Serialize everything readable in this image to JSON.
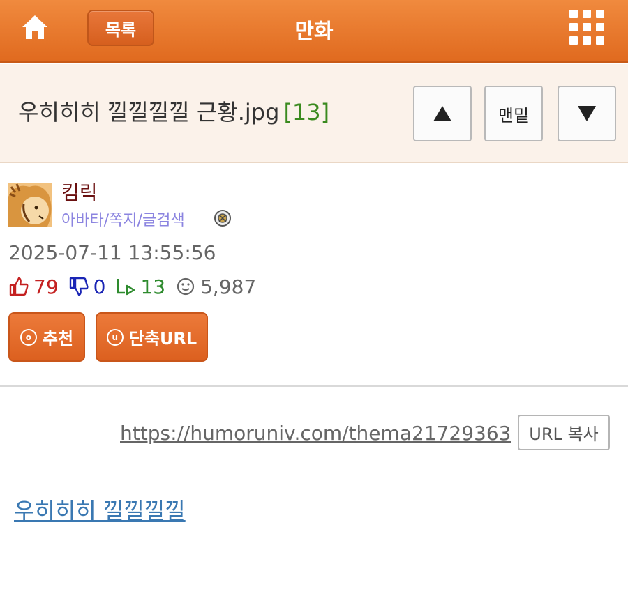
{
  "header": {
    "home_icon": "home-icon",
    "list_label": "목록",
    "title": "만화",
    "menu_icon": "grid-menu-icon"
  },
  "post": {
    "title": "우히히히 낄낄낄낄 근황.jpg",
    "comment_count": "[13]",
    "nav_up_icon": "triangle-up-icon",
    "nav_bottom_label": "맨밑",
    "nav_down_icon": "triangle-down-icon"
  },
  "author": {
    "name": "킴릭",
    "links": "아바타/쪽지/글검색",
    "block_icon": "block-icon"
  },
  "meta": {
    "date": "2025-07-11 13:55:56",
    "upvotes": "79",
    "downvotes": "0",
    "comments": "13",
    "views": "5,987"
  },
  "actions": {
    "recommend_label": "추천",
    "recommend_icon_text": "o",
    "shorturl_label": "단축URL",
    "shorturl_icon_text": "u"
  },
  "url_block": {
    "url": "https://humoruniv.com/thema21729363",
    "copy_label": "URL 복사"
  },
  "content": {
    "link_text": "우히히히 낄낄낄낄"
  },
  "colors": {
    "header_orange": "#e06a1f",
    "title_bg": "#fbf2ea",
    "upvote_red": "#c42121",
    "downvote_blue": "#1a25b5",
    "comment_green": "#2e8b2e",
    "link_blue": "#3a78b2",
    "author_links_purple": "#8b84e0"
  }
}
